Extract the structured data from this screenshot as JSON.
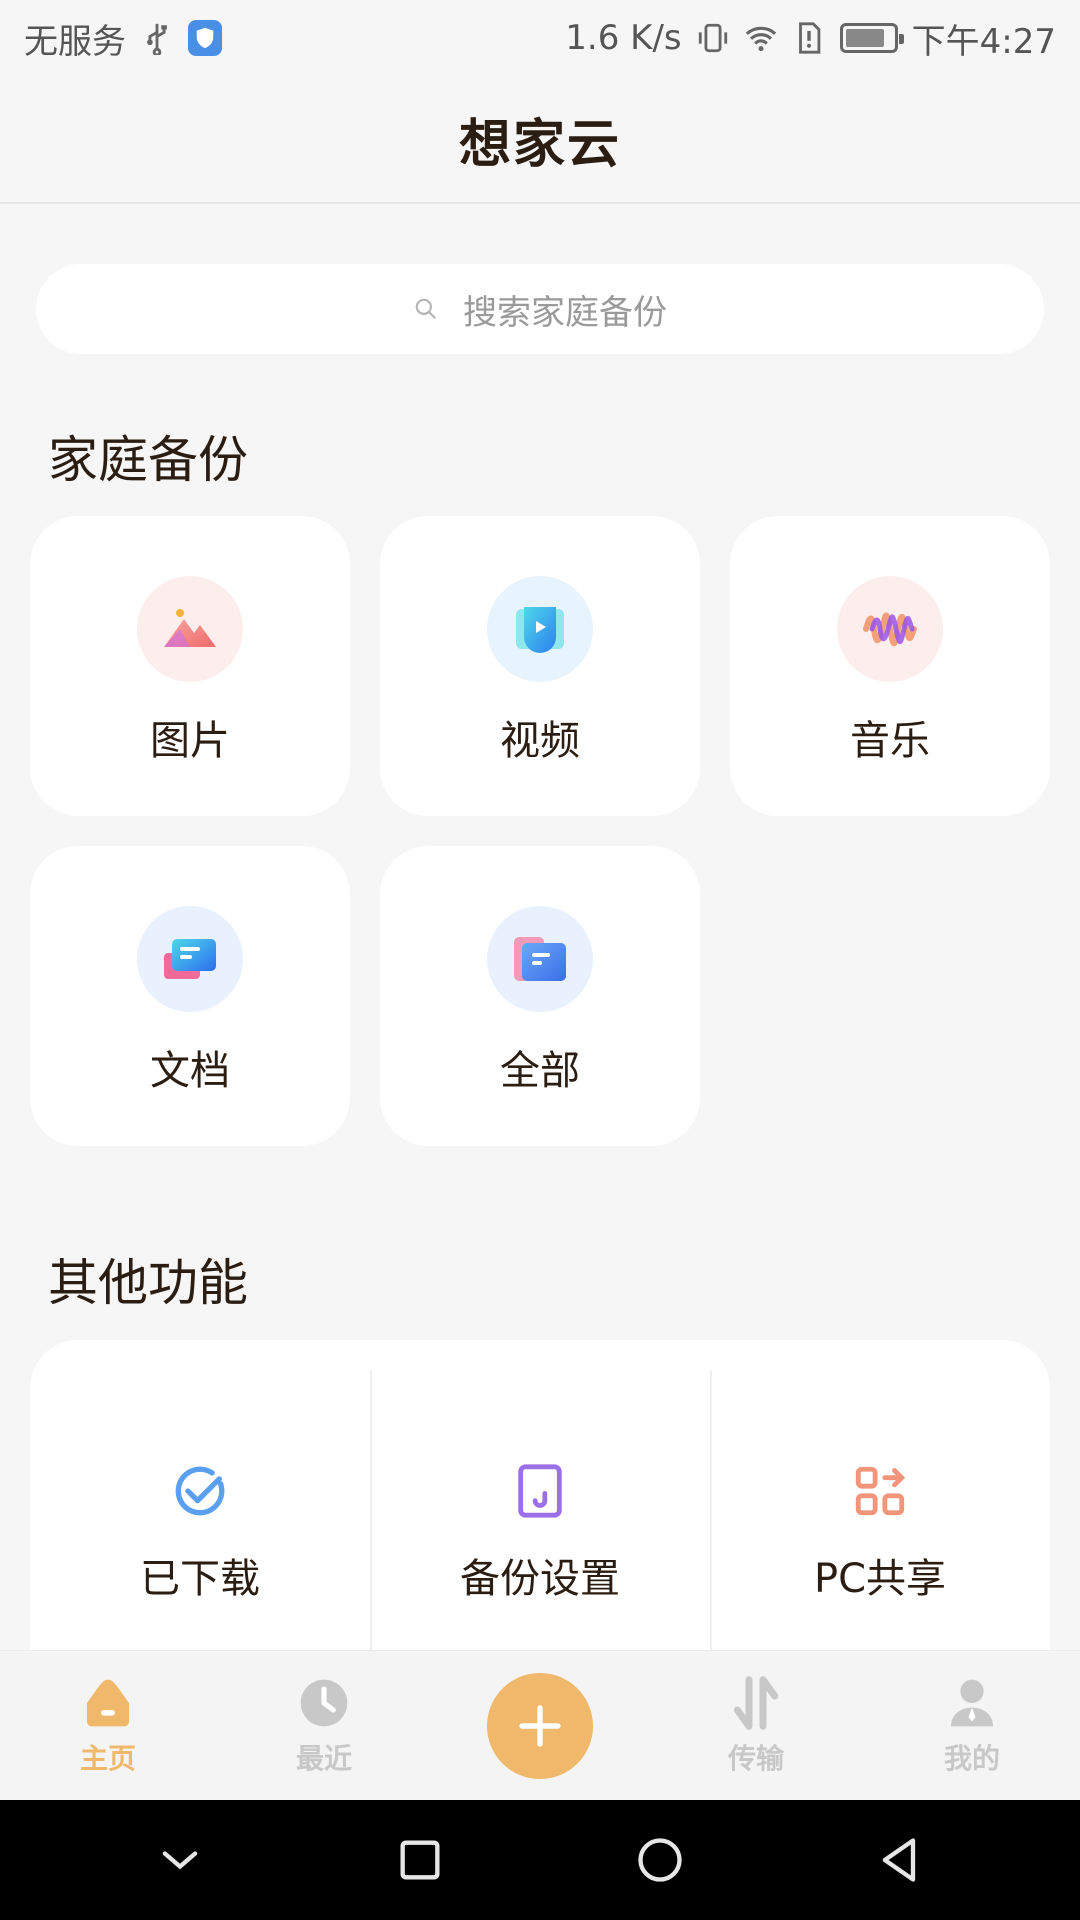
{
  "status_bar": {
    "carrier": "无服务",
    "speed": "1.6 K/s",
    "time": "下午4:27"
  },
  "header": {
    "title": "想家云"
  },
  "search": {
    "placeholder": "搜索家庭备份"
  },
  "backup_section": {
    "title": "家庭备份",
    "items": [
      {
        "label": "图片",
        "icon": "image-icon",
        "bg": "#fdeeee"
      },
      {
        "label": "视频",
        "icon": "video-icon",
        "bg": "#e8f4fd"
      },
      {
        "label": "音乐",
        "icon": "music-icon",
        "bg": "#fdeeee"
      },
      {
        "label": "文档",
        "icon": "document-icon",
        "bg": "#e8f1fd"
      },
      {
        "label": "全部",
        "icon": "folder-icon",
        "bg": "#e8f1fd"
      }
    ]
  },
  "other_section": {
    "title": "其他功能",
    "items": [
      {
        "label": "已下载",
        "icon": "downloaded-check-icon"
      },
      {
        "label": "备份设置",
        "icon": "backup-settings-icon"
      },
      {
        "label": "PC共享",
        "icon": "pc-share-icon"
      }
    ]
  },
  "tabbar": {
    "items": [
      {
        "label": "主页",
        "icon": "home-icon",
        "active": true
      },
      {
        "label": "最近",
        "icon": "clock-icon",
        "active": false
      },
      {
        "label": "",
        "icon": "plus-icon",
        "active": false
      },
      {
        "label": "传输",
        "icon": "transfer-icon",
        "active": false
      },
      {
        "label": "我的",
        "icon": "profile-icon",
        "active": false
      }
    ]
  },
  "colors": {
    "accent": "#efb86a",
    "background": "#f6f6f6",
    "text": "#2b1d12",
    "inactive": "#c8c8c8"
  }
}
